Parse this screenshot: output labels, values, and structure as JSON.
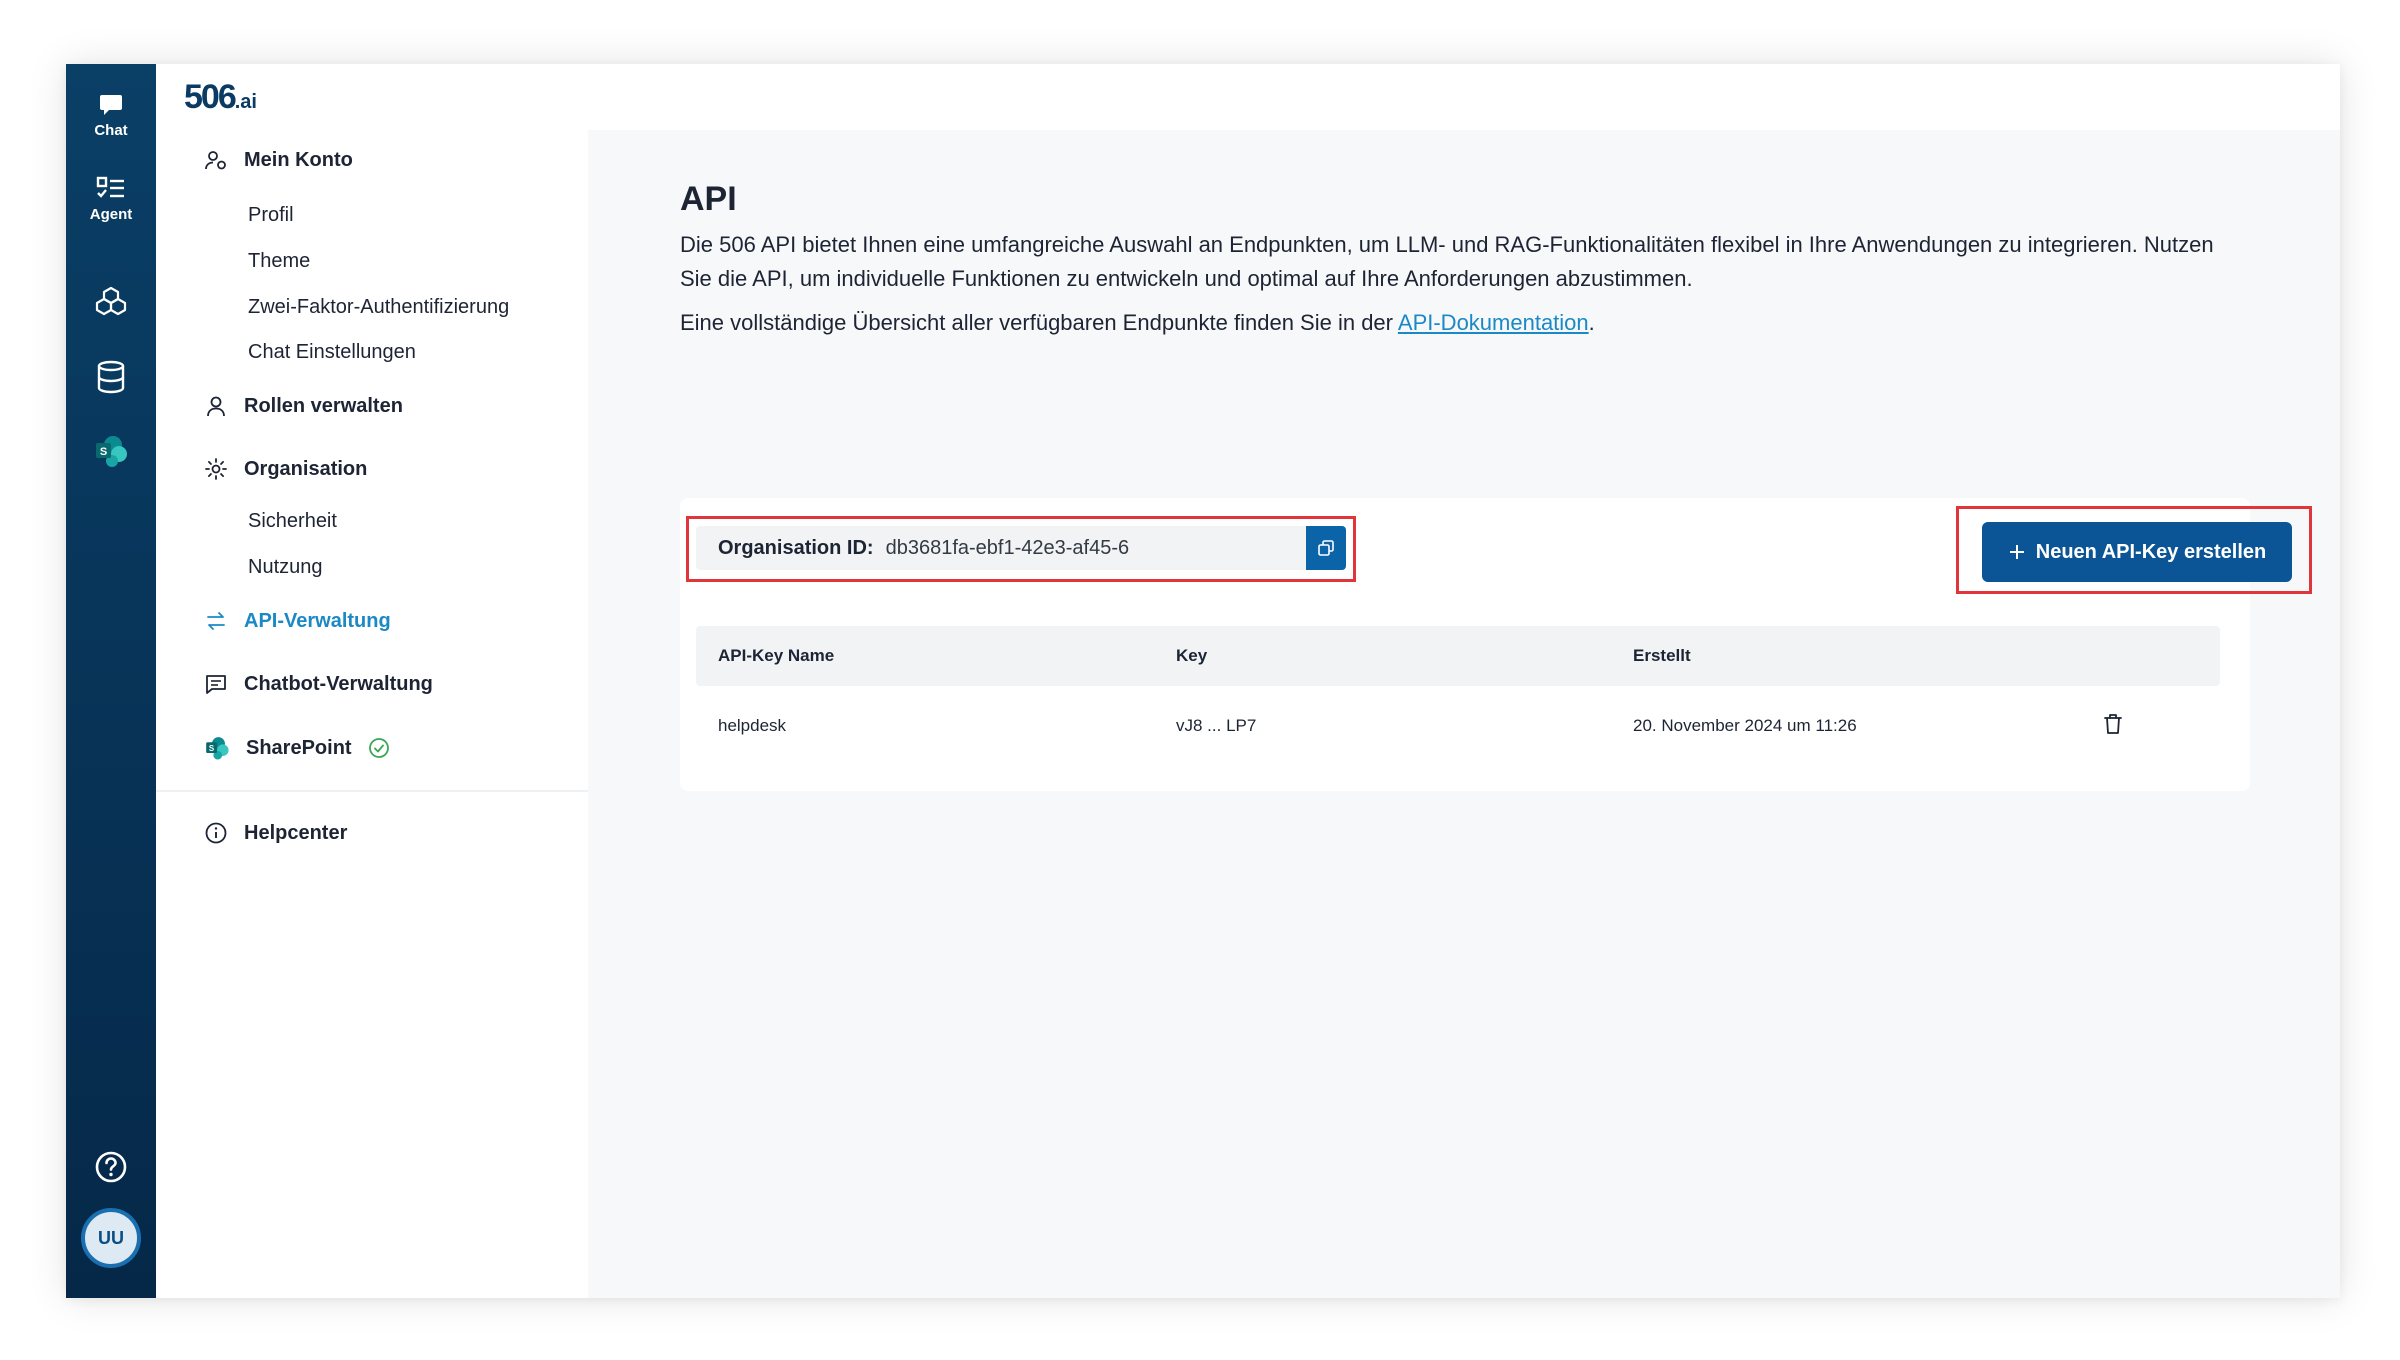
{
  "rail": {
    "chat_label": "Chat",
    "agent_label": "Agent",
    "avatar_initials": "UU"
  },
  "logo": {
    "main": "506",
    "suffix": ".ai"
  },
  "sidebar": {
    "account": "Mein Konto",
    "account_items": [
      "Profil",
      "Theme",
      "Zwei-Faktor-Authentifizierung",
      "Chat Einstellungen"
    ],
    "roles": "Rollen verwalten",
    "organisation": "Organisation",
    "org_items": [
      "Sicherheit",
      "Nutzung"
    ],
    "api": "API-Verwaltung",
    "chatbot": "Chatbot-Verwaltung",
    "sharepoint": "SharePoint",
    "help": "Helpcenter"
  },
  "main": {
    "title": "API",
    "description": "Die 506 API bietet Ihnen eine umfangreiche Auswahl an Endpunkten, um LLM- und RAG-Funktionalitäten flexibel in Ihre Anwendungen zu integrieren. Nutzen Sie die API, um individuelle Funktionen zu entwickeln und optimal auf Ihre Anforderungen abzustimmen.",
    "docs_text": "Eine vollständige Übersicht aller verfügbaren Endpunkte finden Sie in der ",
    "docs_link": "API-Dokumentation",
    "docs_end": ".",
    "org_label": "Organisation ID:",
    "org_value": "db3681fa-ebf1-42e3-af45-6",
    "new_key_button": "Neuen API-Key erstellen",
    "table": {
      "headers": [
        "API-Key Name",
        "Key",
        "Erstellt"
      ],
      "rows": [
        {
          "name": "helpdesk",
          "key": "vJ8 ... LP7",
          "created": "20. November 2024 um 11:26"
        }
      ]
    }
  },
  "colors": {
    "rail": "#08355a",
    "primary": "#0b5596",
    "link": "#1a89c6",
    "highlight": "#e0353b",
    "sharepoint_check": "#3aa658"
  }
}
